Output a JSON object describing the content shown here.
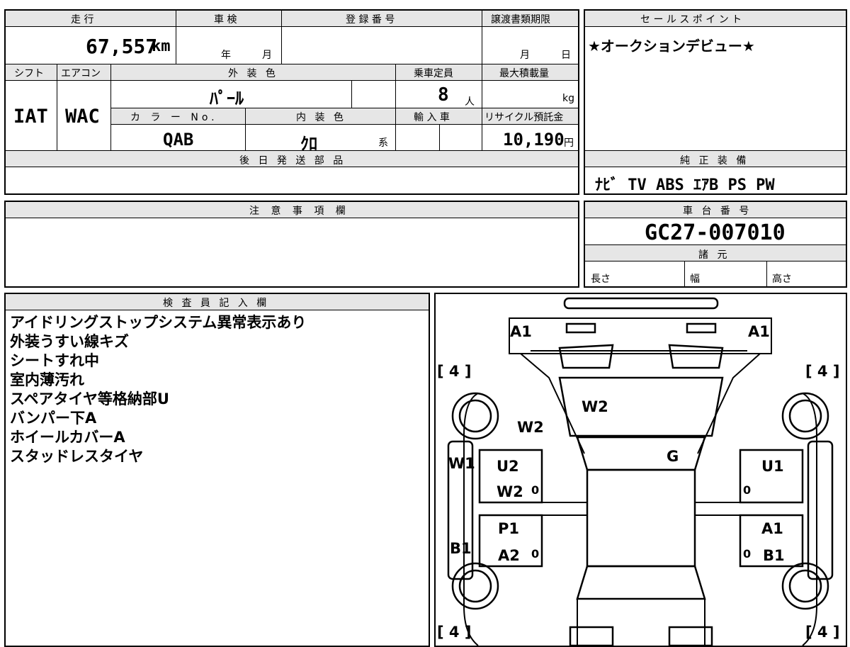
{
  "main_table": {
    "mileage_label": "走 行",
    "mileage_value": "67,557",
    "mileage_unit": "km",
    "shaken_label": "車 検",
    "year_label": "年",
    "month_label": "月",
    "reg_label": "登 録 番 号",
    "transfer_label": "譲渡書類期限",
    "transfer_month": "月",
    "transfer_day": "日",
    "shift_label": "シフト",
    "shift_value": "IAT",
    "ac_label": "エアコン",
    "ac_value": "WAC",
    "exterior_label": "外 装 色",
    "exterior_value": "ﾊﾟｰﾙ",
    "capacity_label": "乗車定員",
    "capacity_value": "8",
    "capacity_unit": "人",
    "maxload_label": "最大積載量",
    "maxload_unit": "kg",
    "color_no_label": "カ ラ ー No.",
    "color_no_value": "QAB",
    "interior_label": "内 装 色",
    "interior_value": "ｸﾛ",
    "interior_suffix": "系",
    "import_label": "輸 入 車",
    "recycle_label": "リサイクル預託金",
    "recycle_value": "10,190",
    "recycle_unit": "円",
    "parts_label": "後 日 発 送 部 品"
  },
  "sales_point": {
    "label": "セ ー ル ス ポ イ ン ト",
    "text": "★オークションデビュー★"
  },
  "equipment": {
    "label": "純 正 装 備",
    "items": "ﾅﾋﾞ  TV  ABS  ｴｱB  PS  PW"
  },
  "caution": {
    "label": "注 意 事 項 欄"
  },
  "chassis": {
    "label": "車 台 番 号",
    "value": "GC27-007010",
    "specs_label": "諸 元",
    "length_label": "長さ",
    "width_label": "幅",
    "height_label": "高さ"
  },
  "inspector": {
    "label": "検 査 員 記 入 欄",
    "notes": [
      "アイドリングストップシステム異常表示あり",
      "外装うすい線キズ",
      "シートすれ中",
      "室内薄汚れ",
      "スペアタイヤ等格納部U",
      "バンパー下A",
      "ホイールカバーA",
      "スタッドレスタイヤ"
    ]
  },
  "diagram": {
    "tire_tl": "[ 4 ]",
    "tire_tr": "[ 4 ]",
    "tire_bl": "[ 4 ]",
    "tire_br": "[ 4 ]",
    "front_left": "A1",
    "front_right": "A1",
    "windshield": "W2",
    "a_pillar_left": "W2",
    "roof": "G",
    "window_left": "W1",
    "front_door_left_1": "U2",
    "front_door_left_2": "W2",
    "front_door_left_zero": "0",
    "front_door_right": "U1",
    "front_door_right_zero": "0",
    "rear_door_left_1": "P1",
    "rear_door_left_2": "A2",
    "rear_door_left_zero": "0",
    "sill_left": "B1",
    "rear_door_right_1": "A1",
    "rear_door_right_2": "B1",
    "rear_door_right_zero": "0"
  }
}
